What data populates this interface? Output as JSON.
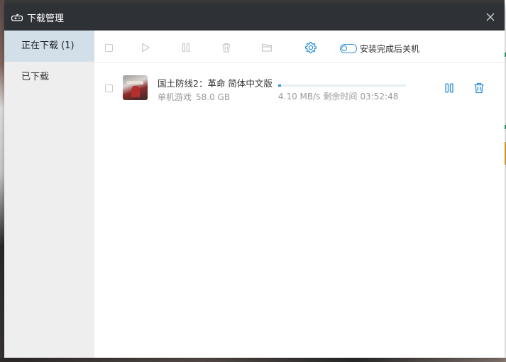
{
  "window": {
    "title": "下载管理"
  },
  "sidebar": {
    "items": [
      {
        "label": "正在下载 (1)",
        "active": true
      },
      {
        "label": "已下载",
        "active": false
      }
    ]
  },
  "toolbar": {
    "shutdown_label": "安装完成后关机",
    "shutdown_enabled": false
  },
  "downloads": [
    {
      "name": "国土防线2：革命 简体中文版",
      "category": "单机游戏",
      "size": "58.0 GB",
      "speed": "4.10 MB/s",
      "remaining_label": "剩余时间",
      "remaining_time": "03:52:48",
      "progress": 0.02
    }
  ],
  "colors": {
    "titlebar_bg": "#2e3136",
    "accent": "#2b8fd6",
    "sidebar_bg": "#eeeeee",
    "sidebar_active_bg": "#d2dfe9",
    "disabled_icon": "#c8c8c8"
  },
  "icons": {
    "app": "gamepad-icon",
    "close": "close-icon",
    "toolbar": [
      "checkbox",
      "play-icon",
      "pause-icon",
      "trash-icon",
      "folder-icon",
      "gear-icon",
      "toggle-switch"
    ],
    "row_actions": [
      "pause-icon",
      "trash-icon"
    ]
  }
}
